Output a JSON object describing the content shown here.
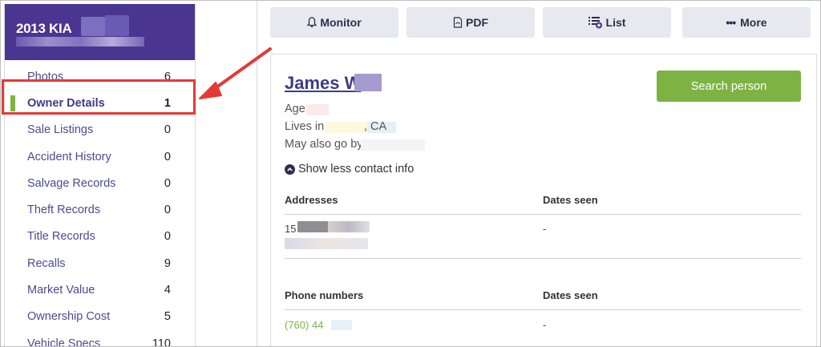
{
  "vehicle": {
    "title": "2013 KIA"
  },
  "sidebar": {
    "items": [
      {
        "label": "Photos",
        "count": "6"
      },
      {
        "label": "Owner Details",
        "count": "1"
      },
      {
        "label": "Sale Listings",
        "count": "0"
      },
      {
        "label": "Accident History",
        "count": "0"
      },
      {
        "label": "Salvage Records",
        "count": "0"
      },
      {
        "label": "Theft Records",
        "count": "0"
      },
      {
        "label": "Title Records",
        "count": "0"
      },
      {
        "label": "Recalls",
        "count": "9"
      },
      {
        "label": "Market Value",
        "count": "4"
      },
      {
        "label": "Ownership Cost",
        "count": "5"
      },
      {
        "label": "Vehicle Specs",
        "count": "110"
      }
    ],
    "active_index": 1
  },
  "toolbar": {
    "monitor": "Monitor",
    "pdf": "PDF",
    "list": "List",
    "more": "More"
  },
  "person": {
    "name": "James W",
    "search_button": "Search person",
    "age_label": "Age",
    "lives_in_label": "Lives in",
    "lives_in_state": ", CA",
    "aka_label": "May also go by",
    "toggle_label": "Show less contact info"
  },
  "addresses": {
    "header": "Addresses",
    "dates_header": "Dates seen",
    "address_prefix": "15",
    "dates_value": "-"
  },
  "phones": {
    "header": "Phone numbers",
    "dates_header": "Dates seen",
    "phone_prefix": "(760) 44",
    "dates_value": "-"
  },
  "colors": {
    "brand_purple": "#4a3590",
    "accent_green": "#7cb342",
    "annotation_red": "#e53935",
    "link_purple": "#3e3b8a"
  }
}
